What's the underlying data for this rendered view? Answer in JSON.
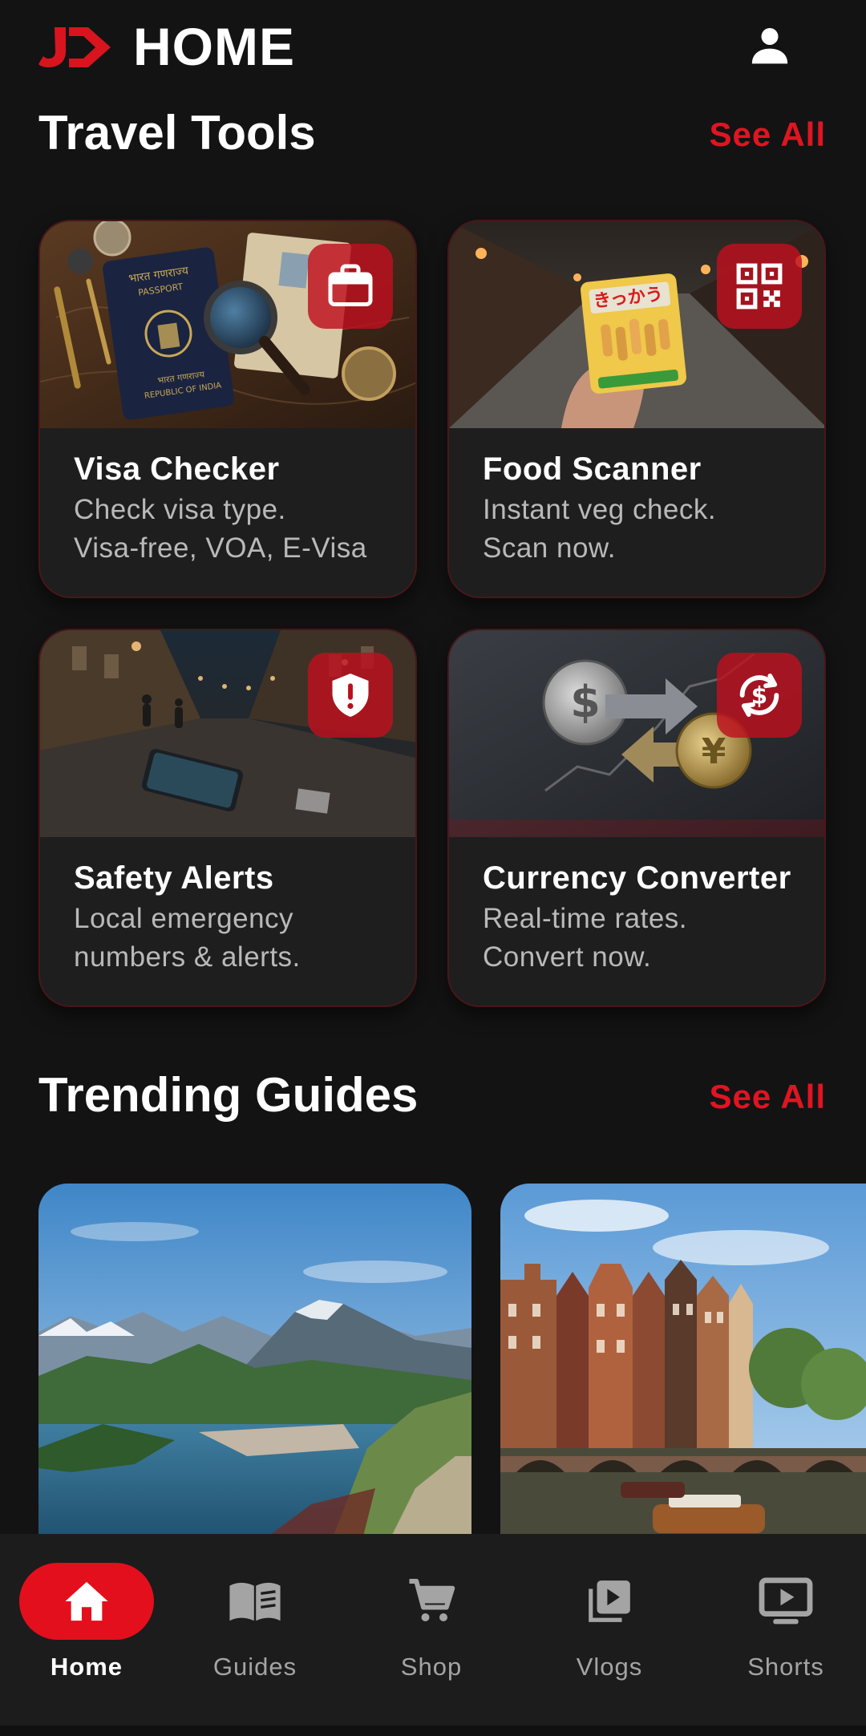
{
  "header": {
    "title": "HOME",
    "logo_text": "JD",
    "profile_icon": "person-icon"
  },
  "travel_tools": {
    "title": "Travel Tools",
    "see_all": "See All",
    "cards": [
      {
        "name": "Visa Checker",
        "desc_line1": "Check visa type.",
        "desc_line2": "Visa-free, VOA, E-Visa",
        "icon": "briefcase-icon"
      },
      {
        "name": "Food Scanner",
        "desc_line1": "Instant veg check.",
        "desc_line2": "Scan now.",
        "icon": "qr-code-icon"
      },
      {
        "name": "Safety Alerts",
        "desc_line1": "Local emergency",
        "desc_line2": "numbers & alerts.",
        "icon": "shield-alert-icon"
      },
      {
        "name": "Currency Converter",
        "desc_line1": "Real-time rates.",
        "desc_line2": "Convert now.",
        "icon": "currency-exchange-icon"
      }
    ]
  },
  "trending_guides": {
    "title": "Trending Guides",
    "see_all": "See All"
  },
  "image_text": {
    "passport_line1": "भारत गणराज्य",
    "passport_line2": "PASSPORT",
    "passport_line3": "भारत गणराज्य",
    "passport_line4": "REPUBLIC OF INDIA",
    "snack_label": "きっかう"
  },
  "bottom_nav": {
    "active": "Home",
    "items": [
      {
        "label": "Home",
        "icon": "home-icon"
      },
      {
        "label": "Guides",
        "icon": "book-icon"
      },
      {
        "label": "Shop",
        "icon": "cart-icon"
      },
      {
        "label": "Vlogs",
        "icon": "video-library-icon"
      },
      {
        "label": "Shorts",
        "icon": "tv-play-icon"
      }
    ]
  },
  "colors": {
    "accent": "#e30f1c",
    "background": "#131314",
    "card": "#1e1e1f",
    "nav": "#1c1c1d"
  }
}
